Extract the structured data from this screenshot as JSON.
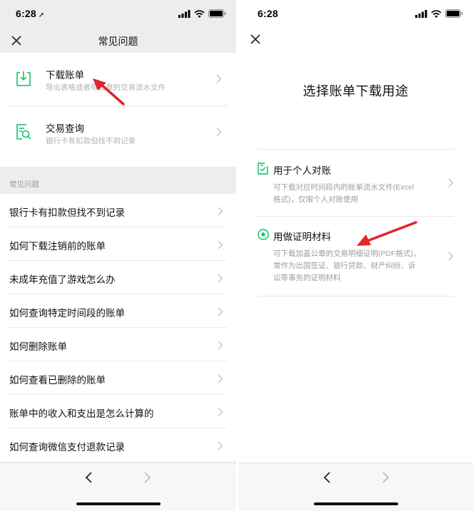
{
  "left": {
    "status_time": "6:28",
    "nav_title": "常见问题",
    "entries": [
      {
        "title": "下载账单",
        "subtitle": "导出表格或者带公章的交易流水文件",
        "icon": "download-file-icon"
      },
      {
        "title": "交易查询",
        "subtitle": "银行卡有扣款但找不到记录",
        "icon": "search-document-icon"
      }
    ],
    "faq_header": "常见问题",
    "faq_items": [
      "银行卡有扣款但找不到记录",
      "如何下载注销前的账单",
      "未成年充值了游戏怎么办",
      "如何查询特定时间段的账单",
      "如何删除账单",
      "如何查看已删除的账单",
      "账单中的收入和支出是怎么计算的",
      "如何查询微信支付退款记录"
    ]
  },
  "right": {
    "status_time": "6:28",
    "heading": "选择账单下载用途",
    "options": [
      {
        "title": "用于个人对账",
        "desc": [
          "可下载对应时间段内的账单流水文件(Excel",
          "格式)，仅限个人对账使用"
        ],
        "icon": "checklist-icon"
      },
      {
        "title": "用做证明材料",
        "desc": [
          "可下载加盖公章的交易明细证明(PDF格式)，",
          "常作为出国签证、银行贷款、财产纠纷、诉",
          "讼等事务的证明材料"
        ],
        "icon": "seal-star-icon"
      }
    ]
  },
  "colors": {
    "accent_green": "#07c160",
    "arrow_red": "#e3242b",
    "muted_text": "#b2b2b2"
  }
}
